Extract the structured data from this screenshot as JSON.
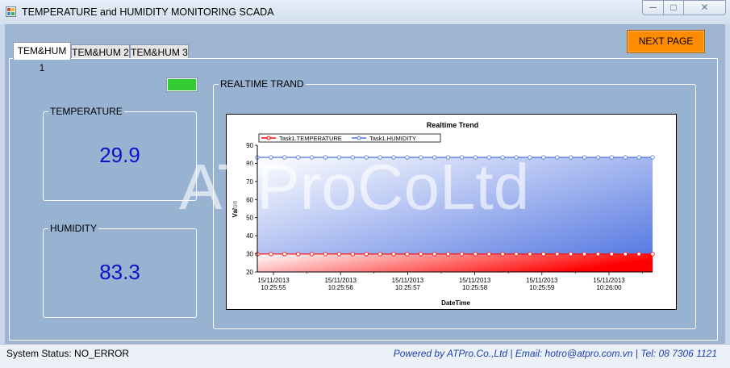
{
  "window": {
    "title": "TEMPERATURE and HUMIDITY MONITORING SCADA",
    "icon": "app-window-icon",
    "controls": {
      "minimize": "minimize-icon",
      "maximize": "maximize-icon",
      "close": "close-icon"
    }
  },
  "toolbar": {
    "next_page_label": "NEXT PAGE",
    "next_page_color": "#ff8c00"
  },
  "tabs": [
    {
      "label": "TEM&HUM 1",
      "active": true
    },
    {
      "label": "TEM&HUM 2",
      "active": false
    },
    {
      "label": "TEM&HUM 3",
      "active": false
    }
  ],
  "indicator": {
    "state": "ok",
    "color": "#33cc33"
  },
  "temperature": {
    "label": "TEMPERATURE",
    "value": "29.9"
  },
  "humidity": {
    "label": "HUMIDITY",
    "value": "83.3"
  },
  "trend": {
    "group_label": "REALTIME TRAND"
  },
  "watermark": "ATProCoLtd",
  "status": {
    "left": "System Status: NO_ERROR",
    "right": "Powered by ATPro.Co.,Ltd | Email: hotro@atpro.com.vn | Tel: 08 7306 1121"
  },
  "chart_data": {
    "type": "area",
    "title": "Realtime Trend",
    "xlabel": "DateTime",
    "ylabel": "Value",
    "ylim": [
      20,
      90
    ],
    "yticks": [
      "20",
      "30",
      "40",
      "50",
      "60",
      "70",
      "80",
      "90"
    ],
    "x_tick_labels": [
      [
        "15/11/2013",
        "10:25:55"
      ],
      [
        "15/11/2013",
        "10:25:56"
      ],
      [
        "15/11/2013",
        "10:25:57"
      ],
      [
        "15/11/2013",
        "10:25:58"
      ],
      [
        "15/11/2013",
        "10:25:59"
      ],
      [
        "15/11/2013",
        "10:26:00"
      ]
    ],
    "points_per_series": 30,
    "legend_position": "top-left",
    "grid": false,
    "series": [
      {
        "name": "Task1.TEMPERATURE",
        "color": "#ff0000",
        "value": 29.9
      },
      {
        "name": "Task1.HUMIDITY",
        "color": "#4a6fe0",
        "value": 83.3
      }
    ]
  }
}
